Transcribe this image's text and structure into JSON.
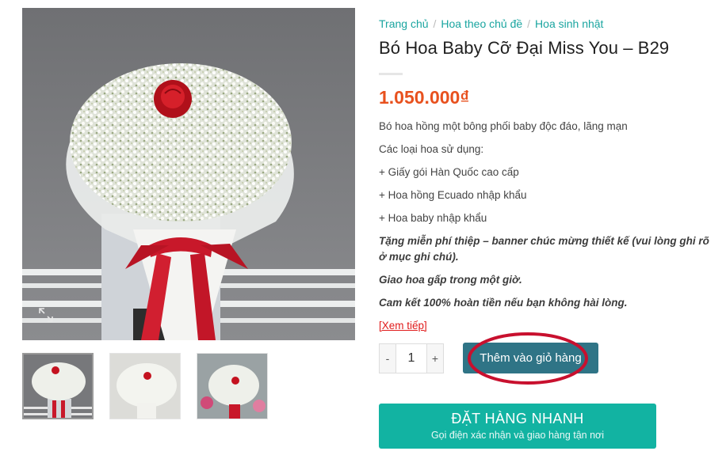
{
  "breadcrumb": {
    "items": [
      "Trang chủ",
      "Hoa theo chủ đề",
      "Hoa sinh nhật"
    ],
    "separator": "/"
  },
  "product": {
    "title": "Bó Hoa Baby Cỡ Đại Miss You – B29",
    "price": "1.050.000₫",
    "description": [
      "Bó hoa hồng một bông phối baby độc đáo, lãng mạn",
      "Các loại hoa sử dụng:",
      "+ Giấy gói Hàn Quốc cao cấp",
      "+ Hoa hồng Ecuado nhập khẩu",
      "+ Hoa baby nhập khẩu"
    ],
    "highlights": [
      "Tặng miễn phí thiệp – banner chúc mừng thiết kế (vui lòng ghi rõ ở mục ghi chú).",
      "Giao hoa gấp trong một giờ.",
      "Cam kết 100% hoàn tiền nếu bạn không hài lòng."
    ],
    "read_more": "[Xem tiếp]"
  },
  "quantity": {
    "minus": "-",
    "value": "1",
    "plus": "+"
  },
  "actions": {
    "add_to_cart": "Thêm vào giỏ hàng",
    "order_now": "ĐẶT HÀNG NHANH",
    "order_now_sub": "Gọi điện xác nhận và giao hàng tận nơi"
  },
  "gallery": {
    "thumbnail_count": 3,
    "active_thumbnail": 1,
    "zoom_icon": "expand-icon"
  },
  "colors": {
    "link": "#1aa5a0",
    "price": "#e8511e",
    "add_to_cart": "#2f7486",
    "order_now": "#12b3a2",
    "read_more": "#e01b1b",
    "annotation": "#c8102e"
  }
}
